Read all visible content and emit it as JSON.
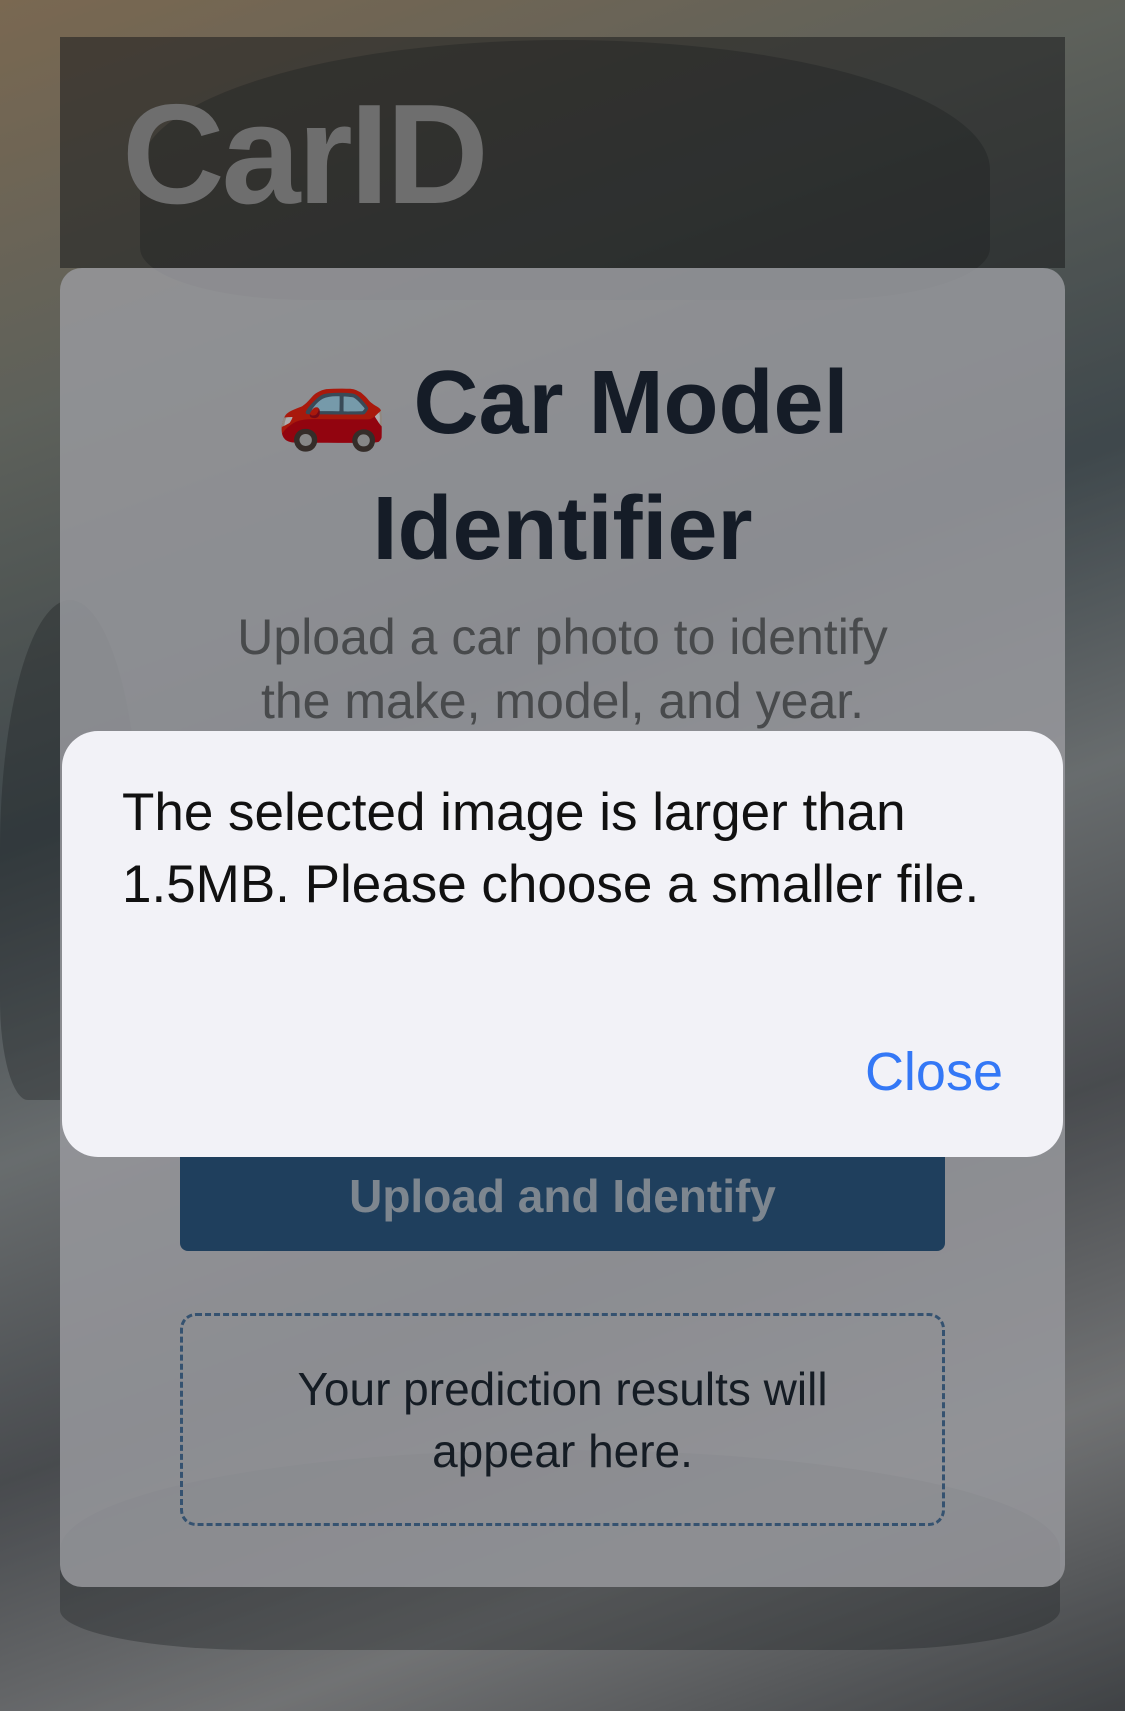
{
  "header": {
    "logo": "CarID"
  },
  "card": {
    "icon": "🚗",
    "title": "Car Model Identifier",
    "subtitle": "Upload a car photo to identify the make, model, and year.",
    "upload_button": "Upload and Identify",
    "results_placeholder": "Your prediction results will appear here."
  },
  "dialog": {
    "message": "The selected image is larger than 1.5MB. Please choose a smaller file.",
    "close_label": "Close"
  },
  "colors": {
    "accent": "#3478f6",
    "button": "#2f5d89",
    "title": "#1f2a3a"
  }
}
